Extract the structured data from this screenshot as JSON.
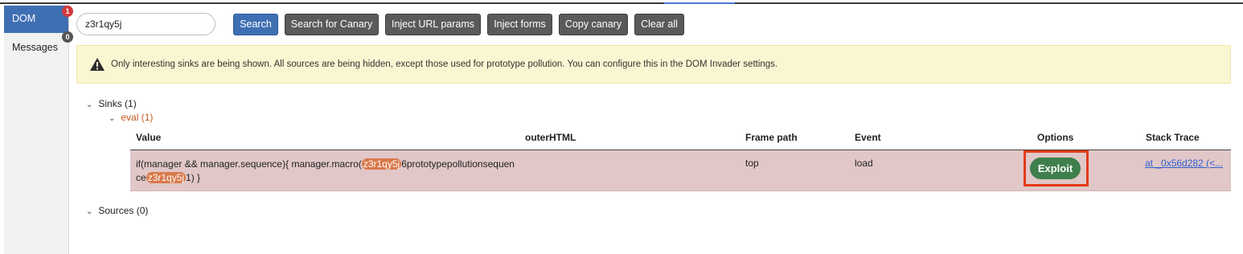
{
  "left_tabs": [
    {
      "label": "DOM",
      "badge": "1"
    },
    {
      "label": "Messages",
      "badge": "0"
    }
  ],
  "search": {
    "value": "z3r1qy5j"
  },
  "toolbar": {
    "search_label": "Search",
    "search_canary_label": "Search for Canary",
    "inject_url_label": "Inject URL params",
    "inject_forms_label": "Inject forms",
    "copy_canary_label": "Copy canary",
    "clear_all_label": "Clear all"
  },
  "banner": {
    "icon": "warning-icon",
    "text": "Only interesting sinks are being shown. All sources are being hidden, except those used for prototype pollution. You can configure this in the DOM Invader settings."
  },
  "tree": {
    "sinks_label": "Sinks (1)",
    "eval_label": "eval (1)",
    "sources_label": "Sources (0)"
  },
  "table": {
    "headers": [
      "Value",
      "outerHTML",
      "Frame path",
      "Event",
      "Options",
      "Stack Trace"
    ],
    "row": {
      "value_part1": "if(manager && manager.sequence){ manager.macro(",
      "canary1": "z3r1qy5j",
      "value_part2": "6prototypepollutionsequen",
      "value_part3": "ce",
      "canary2": "z3r1qy5j",
      "value_part4": "1) }",
      "outer_html": "",
      "frame_path": "top",
      "event": "load",
      "exploit_label": "Exploit",
      "stack_trace": "at _0x56d282 (<..."
    }
  },
  "colors": {
    "primary": "#3f6fb3",
    "grey_button": "#5a5a5a",
    "banner_bg": "#fbf6d2",
    "row_bg": "#e1c7c7",
    "canary_highlight": "#d9794a",
    "exploit_green": "#3f7f4c",
    "exploit_outline": "#e33a1a",
    "eval_orange": "#c0561c"
  }
}
